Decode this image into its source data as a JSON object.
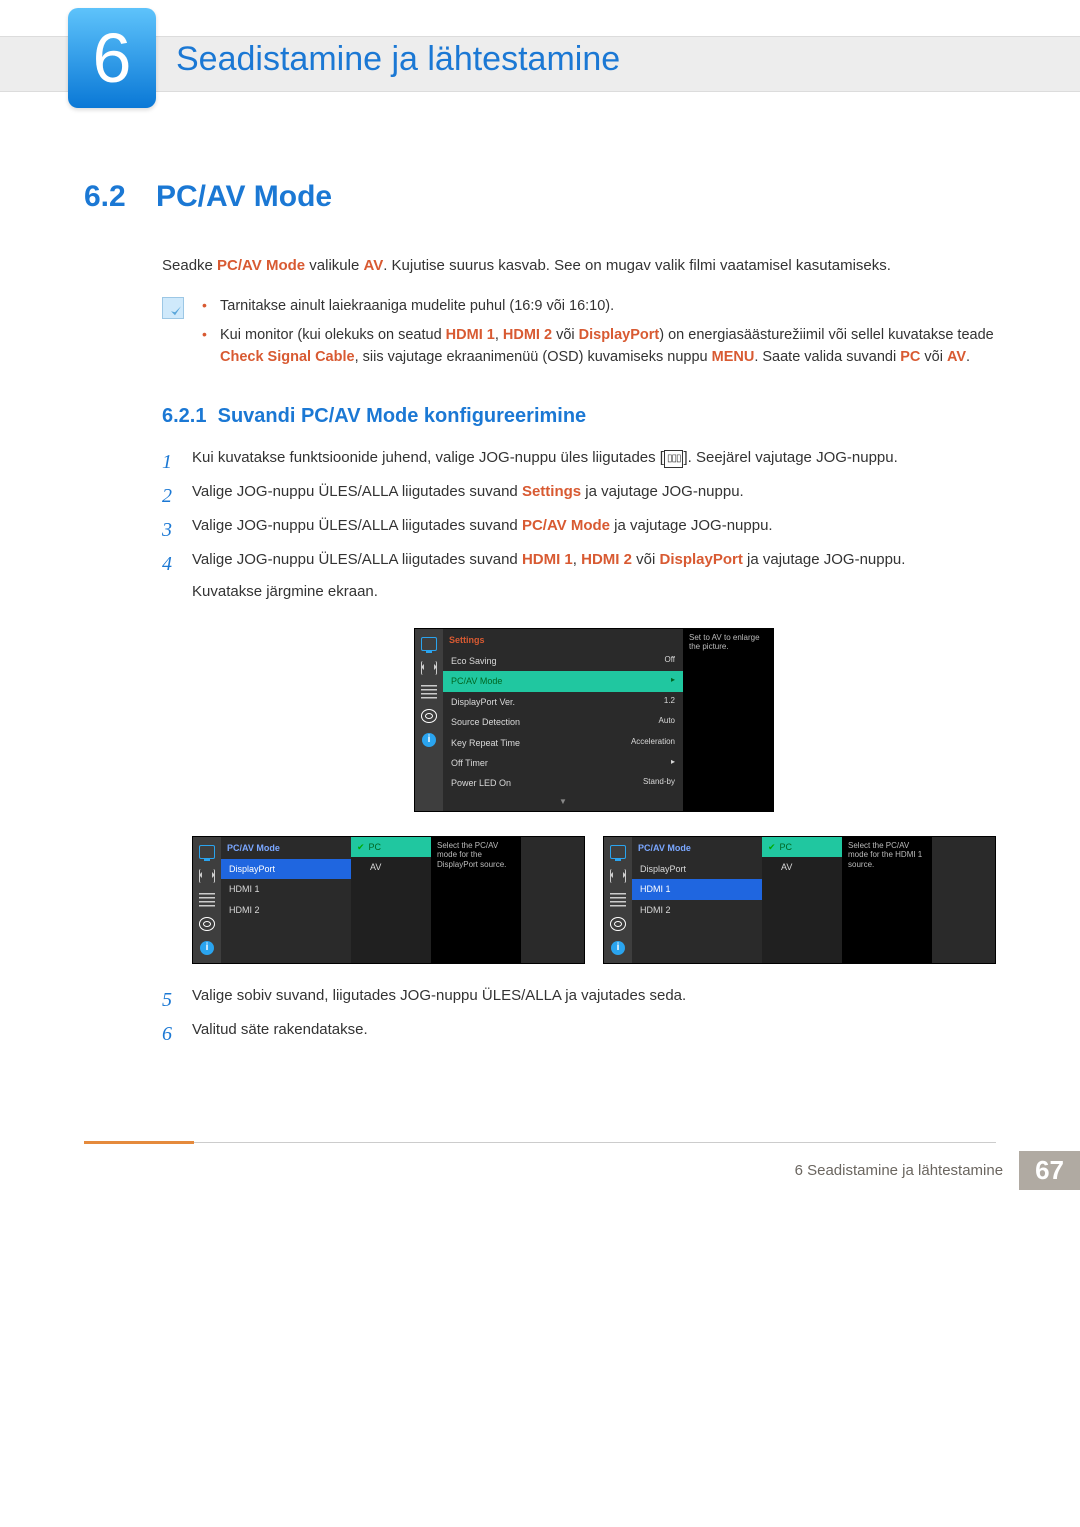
{
  "header": {
    "chapter_number": "6",
    "chapter_title": "Seadistamine ja lähtestamine"
  },
  "section": {
    "number": "6.2",
    "title": "PC/AV Mode"
  },
  "intro": {
    "pre": "Seadke ",
    "k1": "PC/AV Mode",
    "mid": " valikule ",
    "k2": "AV",
    "post": ". Kujutise suurus kasvab. See on mugav valik filmi vaatamisel kasutamiseks."
  },
  "notes": {
    "n1": "Tarnitakse ainult laiekraaniga mudelite puhul (16:9 või 16:10).",
    "n2": {
      "a": "Kui monitor (kui olekuks on seatud ",
      "k1": "HDMI 1",
      "b": ", ",
      "k2": "HDMI 2",
      "c": " või ",
      "k3": "DisplayPort",
      "d": ") on energiasäästurežiimil või sellel kuvatakse teade ",
      "k4": "Check Signal Cable",
      "e": ", siis vajutage ekraanimenüü (OSD) kuvamiseks nuppu ",
      "k5": "MENU",
      "f": ". Saate valida suvandi ",
      "k6": "PC",
      "g": " või ",
      "k7": "AV",
      "h": "."
    }
  },
  "subsection": {
    "number": "6.2.1",
    "title": "Suvandi PC/AV Mode konfigureerimine"
  },
  "steps": {
    "s1": {
      "n": "1",
      "a": "Kui kuvatakse funktsioonide juhend, valige JOG-nuppu üles liigutades [",
      "b": "]. Seejärel vajutage JOG-nuppu."
    },
    "s2": {
      "n": "2",
      "a": "Valige JOG-nuppu ÜLES/ALLA liigutades suvand ",
      "k": "Settings",
      "b": " ja vajutage JOG-nuppu."
    },
    "s3": {
      "n": "3",
      "a": "Valige JOG-nuppu ÜLES/ALLA liigutades suvand ",
      "k": "PC/AV Mode",
      "b": " ja vajutage JOG-nuppu."
    },
    "s4": {
      "n": "4",
      "a": "Valige JOG-nuppu ÜLES/ALLA liigutades suvand ",
      "k1": "HDMI 1",
      "b": ", ",
      "k2": "HDMI 2",
      "c": " või ",
      "k3": "DisplayPort",
      "d": " ja vajutage JOG-nuppu.",
      "below": "Kuvatakse järgmine ekraan."
    },
    "s5": {
      "n": "5",
      "t": "Valige sobiv suvand, liigutades JOG-nuppu ÜLES/ALLA ja vajutades seda."
    },
    "s6": {
      "n": "6",
      "t": "Valitud säte rakendatakse."
    }
  },
  "osd_big": {
    "title": "Settings",
    "rows": [
      {
        "l": "Eco Saving",
        "r": "Off"
      },
      {
        "l": "PC/AV Mode",
        "r": "▸",
        "sel": true
      },
      {
        "l": "DisplayPort Ver.",
        "r": "1.2"
      },
      {
        "l": "Source Detection",
        "r": "Auto"
      },
      {
        "l": "Key Repeat Time",
        "r": "Acceleration"
      },
      {
        "l": "Off Timer",
        "r": "▸"
      },
      {
        "l": "Power LED On",
        "r": "Stand-by"
      }
    ],
    "tip": "Set to AV to enlarge the picture."
  },
  "osd_left": {
    "title": "PC/AV Mode",
    "rows": [
      {
        "l": "DisplayPort",
        "sel": true
      },
      {
        "l": "HDMI 1"
      },
      {
        "l": "HDMI 2"
      }
    ],
    "sub": [
      {
        "l": "PC",
        "sel": true,
        "chk": true
      },
      {
        "l": "AV"
      }
    ],
    "tip": "Select the PC/AV mode for the DisplayPort source."
  },
  "osd_right": {
    "title": "PC/AV Mode",
    "rows": [
      {
        "l": "DisplayPort"
      },
      {
        "l": "HDMI 1",
        "sel": true
      },
      {
        "l": "HDMI 2"
      }
    ],
    "sub": [
      {
        "l": "PC",
        "sel": true,
        "chk": true
      },
      {
        "l": "AV"
      }
    ],
    "tip": "Select the PC/AV mode for the HDMI 1 source."
  },
  "footer": {
    "caption": "6 Seadistamine ja lähtestamine",
    "page": "67"
  }
}
